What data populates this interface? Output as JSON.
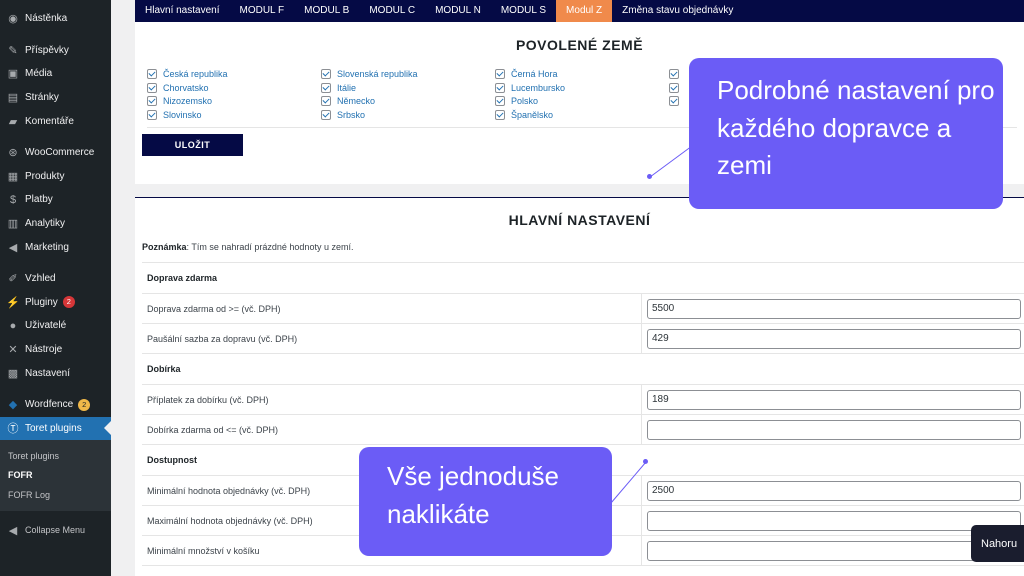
{
  "sidebar": {
    "items": [
      {
        "label": "Nástěnka",
        "icon": "dashboard-icon"
      },
      {
        "label": "Příspěvky",
        "icon": "pin-icon"
      },
      {
        "label": "Média",
        "icon": "media-icon"
      },
      {
        "label": "Stránky",
        "icon": "pages-icon"
      },
      {
        "label": "Komentáře",
        "icon": "comments-icon"
      },
      {
        "label": "WooCommerce",
        "icon": "woo-icon"
      },
      {
        "label": "Produkty",
        "icon": "products-icon"
      },
      {
        "label": "Platby",
        "icon": "payments-icon"
      },
      {
        "label": "Analytiky",
        "icon": "analytics-icon"
      },
      {
        "label": "Marketing",
        "icon": "marketing-icon"
      },
      {
        "label": "Vzhled",
        "icon": "appearance-icon"
      },
      {
        "label": "Pluginy",
        "icon": "plugins-icon",
        "badge": "2"
      },
      {
        "label": "Uživatelé",
        "icon": "users-icon"
      },
      {
        "label": "Nástroje",
        "icon": "tools-icon"
      },
      {
        "label": "Nastavení",
        "icon": "settings-icon"
      },
      {
        "label": "Wordfence",
        "icon": "wordfence-icon",
        "badge": "2"
      },
      {
        "label": "Toret plugins",
        "icon": "toret-icon"
      }
    ],
    "submenu": [
      "Toret plugins",
      "FOFR",
      "FOFR Log"
    ],
    "collapse_label": "Collapse Menu"
  },
  "tabs": [
    "Hlavní nastavení",
    "MODUL F",
    "MODUL B",
    "MODUL C",
    "MODUL N",
    "MODUL S",
    "Modul Z",
    "Změna stavu objednávky"
  ],
  "countries_section": {
    "title": "POVOLENÉ ZEMĚ",
    "countries": [
      "Česká republika",
      "Slovenská republika",
      "Černá Hora",
      "Chorvatsko",
      "Itálie",
      "Lucembursko",
      "Nizozemsko",
      "Německo",
      "Polsko",
      "Slovinsko",
      "Srbsko",
      "Španělsko"
    ],
    "save_label": "ULOŽIT"
  },
  "main_settings": {
    "title": "HLAVNÍ NASTAVENÍ",
    "note_label": "Poznámka",
    "note_text": ": Tím se nahradí prázdné hodnoty u zemí.",
    "sections": [
      {
        "title": "Doprava zdarma",
        "fields": [
          {
            "label": "Doprava zdarma od >= (vč. DPH)",
            "value": "5500"
          },
          {
            "label": "Paušální sazba za dopravu (vč. DPH)",
            "value": "429"
          }
        ]
      },
      {
        "title": "Dobírka",
        "fields": [
          {
            "label": "Příplatek za dobírku (vč. DPH)",
            "value": "189"
          },
          {
            "label": "Dobírka zdarma od <= (vč. DPH)",
            "value": ""
          }
        ]
      },
      {
        "title": "Dostupnost",
        "fields": [
          {
            "label": "Minimální hodnota objednávky (vč. DPH)",
            "value": "2500"
          },
          {
            "label": "Maximální hodnota objednávky (vč. DPH)",
            "value": ""
          },
          {
            "label": "Minimální množství v košíku",
            "value": ""
          }
        ]
      }
    ]
  },
  "callouts": {
    "first": "Podrobné nastavení pro každého dopravce a zemi",
    "second": "Vše jednoduše naklikáte"
  },
  "back_to_top": "Nahoru"
}
